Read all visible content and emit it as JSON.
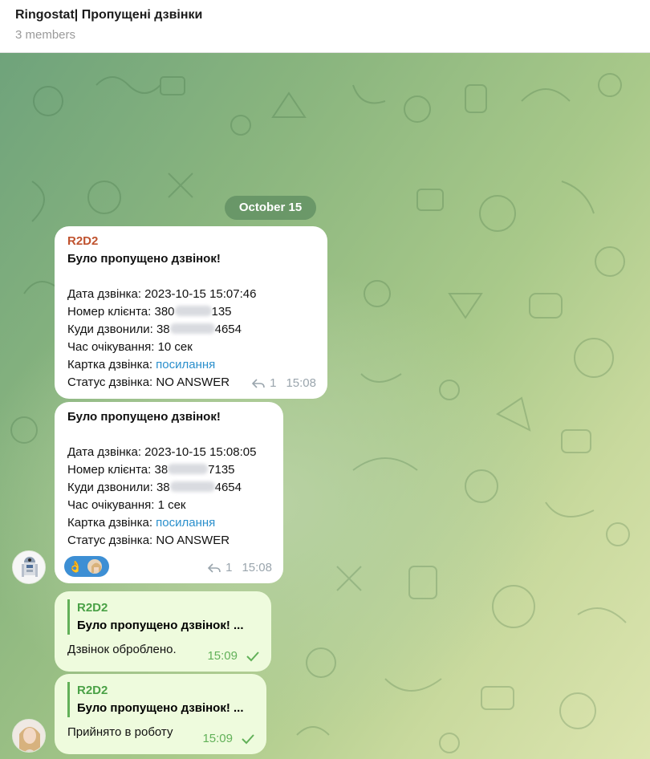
{
  "header": {
    "title": "Ringostat| Пропущені дзвінки",
    "subtitle": "3 members"
  },
  "date_pill": "October 15",
  "messages": [
    {
      "sender": "R2D2",
      "title": "Було пропущено дзвінок!",
      "date_line": "Дата дзвінка: 2023-10-15 15:07:46",
      "client_prefix": "Номер клієнта: 380",
      "client_suffix": "135",
      "called_prefix": "Куди дзвонили: 38",
      "called_suffix": "4654",
      "wait_line": "Час очікування: 10 сек",
      "card_label": "Картка дзвінка: ",
      "card_link": "посилання",
      "status_line": "Статус дзвінка: NO ANSWER",
      "replies": "1",
      "time": "15:08"
    },
    {
      "title": "Було пропущено дзвінок!",
      "date_line": "Дата дзвінка: 2023-10-15 15:08:05",
      "client_prefix": "Номер клієнта: 38",
      "client_suffix": "7135",
      "called_prefix": "Куди дзвонили: 38",
      "called_suffix": "4654",
      "wait_line": "Час очікування: 1 сек",
      "card_label": "Картка дзвінка: ",
      "card_link": "посилання",
      "status_line": "Статус дзвінка: NO ANSWER",
      "reactions": [
        "👌"
      ],
      "replies": "1",
      "time": "15:08"
    },
    {
      "quote_name": "R2D2",
      "quote_text": "Було пропущено дзвінок!  ...",
      "text": "Дзвінок оброблено.",
      "time": "15:09"
    },
    {
      "quote_name": "R2D2",
      "quote_text": "Було пропущено дзвінок! ...",
      "text": "Прийнято в роботу",
      "time": "15:09"
    }
  ],
  "colors": {
    "sender": "#c0532f",
    "link": "#2a8fcc",
    "outgoing_bubble": "#eefbdd",
    "outgoing_meta": "#62b159"
  }
}
